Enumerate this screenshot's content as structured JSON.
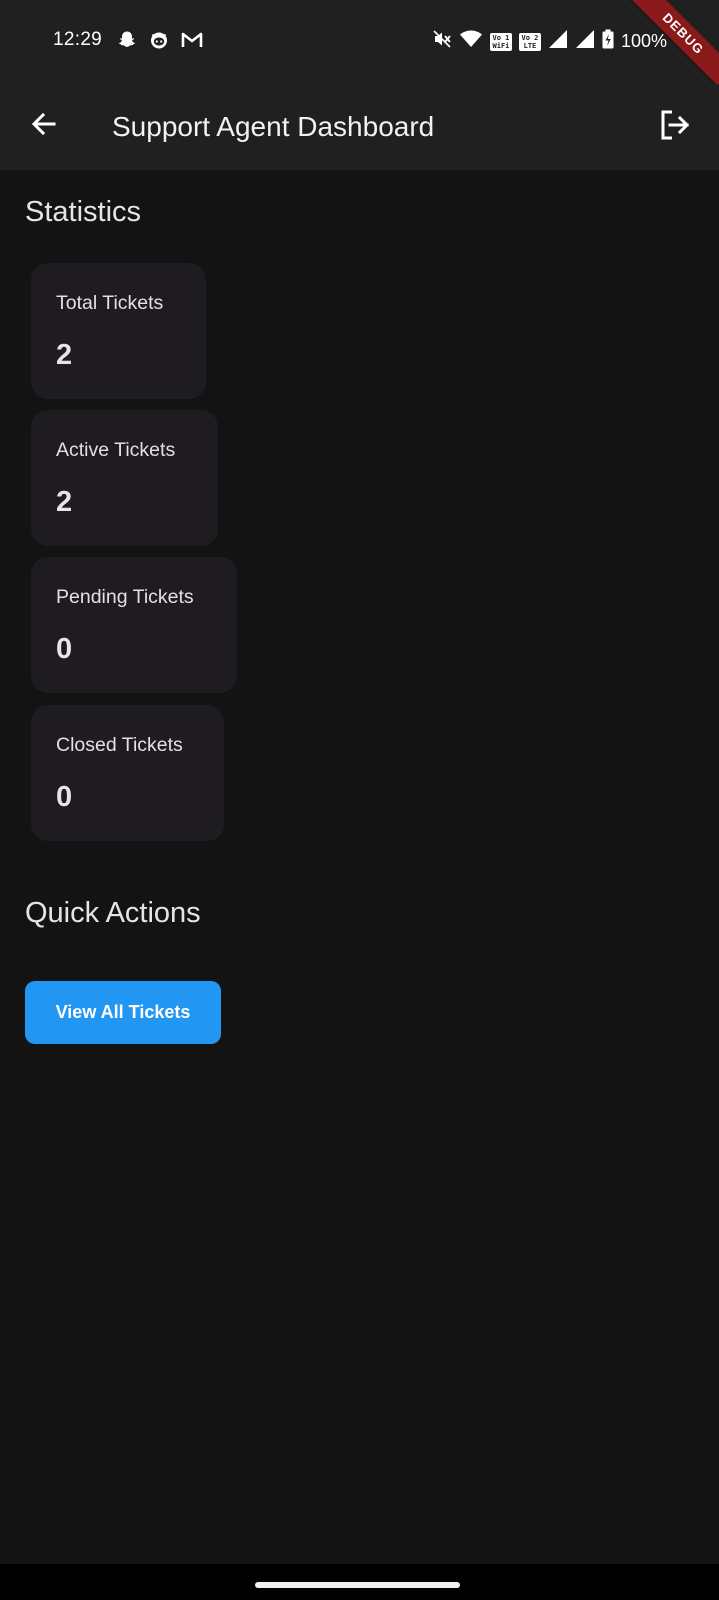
{
  "status_bar": {
    "time": "12:29",
    "battery": "100%",
    "left_icons": [
      "snapchat-icon",
      "octocat-icon",
      "gmail-icon"
    ],
    "right_icons": [
      "mute-icon",
      "wifi-icon",
      "vowifi-1-icon",
      "volte-2-icon",
      "signal-1-icon",
      "signal-2-icon",
      "battery-charging-icon"
    ],
    "vowifi_badge": "Vo 1\nWiFi",
    "volte_badge": "Vo 2\nLTE"
  },
  "debug_banner": "DEBUG",
  "app_bar": {
    "title": "Support Agent Dashboard",
    "back_icon": "arrow-back-icon",
    "logout_icon": "logout-icon"
  },
  "statistics": {
    "title": "Statistics",
    "cards": [
      {
        "label": "Total Tickets",
        "value": "2"
      },
      {
        "label": "Active Tickets",
        "value": "2"
      },
      {
        "label": "Pending Tickets",
        "value": "0"
      },
      {
        "label": "Closed Tickets",
        "value": "0"
      }
    ]
  },
  "quick_actions": {
    "title": "Quick Actions",
    "view_all_label": "View All Tickets"
  },
  "colors": {
    "background": "#131313",
    "app_bar": "#202020",
    "card": "#1e1c21",
    "primary_button": "#2196f3",
    "debug_ribbon": "#8a1a1a"
  }
}
